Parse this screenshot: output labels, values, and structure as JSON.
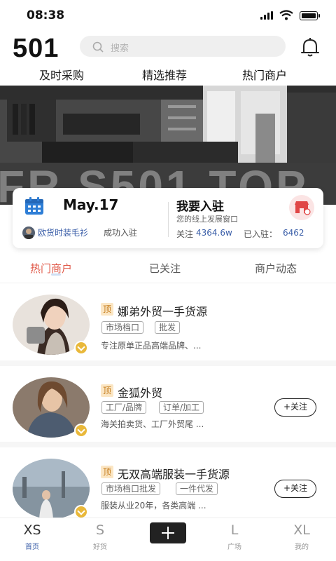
{
  "status": {
    "time": "08:38"
  },
  "header": {
    "logo": "501",
    "search_placeholder": "搜索"
  },
  "top_tabs": [
    "及时采购",
    "精选推荐",
    "热门商户"
  ],
  "banner": {
    "text": "FR S501 TOP"
  },
  "info_card": {
    "date": "May.17",
    "news_name": "欧货时装毛衫",
    "news_action": "成功入驻",
    "join_title": "我要入驻",
    "join_sub": "您的线上发展窗口",
    "follow_label": "关注",
    "follow_value": "4364.6w",
    "joined_label": "已入驻：",
    "joined_value": "6462"
  },
  "sub_tabs": [
    "热门商户",
    "已关注",
    "商户动态"
  ],
  "merchants": [
    {
      "badge": "顶",
      "name": "娜弟外贸一手货源",
      "tags": [
        "市场档口",
        "批发"
      ],
      "desc": "专注原单正品高端品牌、..."
    },
    {
      "badge": "顶",
      "name": "金狐外贸",
      "tags": [
        "工厂/品牌",
        "订单/加工"
      ],
      "desc": "海关拍卖货、工厂外贸尾 ...",
      "follow": "+关注"
    },
    {
      "badge": "顶",
      "name": "无双高端服装一手货源",
      "tags": [
        "市场档口批发",
        "一件代发"
      ],
      "desc": "服装从业20年，各类高端 ...",
      "follow": "+关注"
    }
  ],
  "bottom_nav": [
    {
      "letter": "XS",
      "label": "首页"
    },
    {
      "letter": "S",
      "label": "好货"
    },
    {
      "letter": "L",
      "label": "广场"
    },
    {
      "letter": "XL",
      "label": "我的"
    }
  ],
  "colors": {
    "accent_red": "#e05a4a",
    "link_blue": "#3a5ea8",
    "badge_gold": "#e9b83a"
  }
}
